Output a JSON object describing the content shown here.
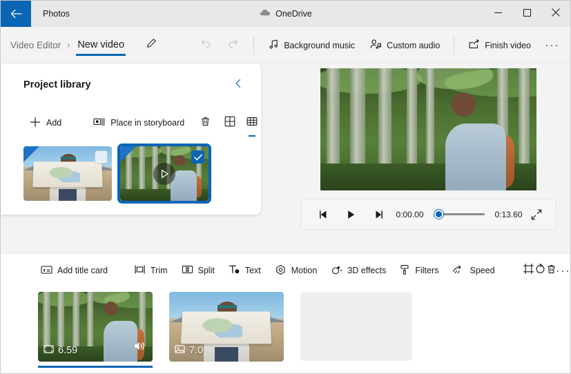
{
  "window": {
    "back_icon": "back-arrow-icon",
    "app_name": "Photos",
    "cloud_label": "OneDrive",
    "minimize": "minimize-icon",
    "maximize": "maximize-icon",
    "close": "close-icon"
  },
  "commandbar": {
    "breadcrumb_parent": "Video Editor",
    "breadcrumb_separator": "›",
    "breadcrumb_current": "New video",
    "rename_icon": "pencil-icon",
    "undo_icon": "undo-icon",
    "redo_icon": "redo-icon",
    "background_music": "Background music",
    "custom_audio": "Custom audio",
    "finish_video": "Finish video",
    "overflow": "···"
  },
  "library": {
    "title": "Project library",
    "collapse_icon": "chevron-left-icon",
    "add_label": "Add",
    "place_label": "Place in storyboard",
    "delete_icon": "trash-icon",
    "view_large_icon": "grid-large-icon",
    "view_small_icon": "grid-small-icon",
    "active_view": "grid-small-icon",
    "items": [
      {
        "name": "map-photo",
        "kind": "photo",
        "selected": false
      },
      {
        "name": "forest-video",
        "kind": "video",
        "selected": true
      }
    ]
  },
  "player": {
    "prev_frame_icon": "previous-frame-icon",
    "play_icon": "play-icon",
    "next_frame_icon": "next-frame-icon",
    "current_time": "0:00.00",
    "total_time": "0:13.60",
    "progress_percent": 0,
    "fullscreen_icon": "expand-icon"
  },
  "edit_toolbar": {
    "items": [
      {
        "label": "Add title card",
        "icon": "title-card-icon"
      },
      {
        "label": "Trim",
        "icon": "trim-icon"
      },
      {
        "label": "Split",
        "icon": "split-icon"
      },
      {
        "label": "Text",
        "icon": "text-icon"
      },
      {
        "label": "Motion",
        "icon": "motion-icon"
      },
      {
        "label": "3D effects",
        "icon": "three-d-effects-icon"
      },
      {
        "label": "Filters",
        "icon": "filters-icon"
      },
      {
        "label": "Speed",
        "icon": "speed-icon"
      }
    ],
    "crop_icon": "crop-icon",
    "rotate_icon": "rotate-icon",
    "delete_icon": "trash-icon",
    "overflow": "···"
  },
  "storyboard": {
    "clips": [
      {
        "name": "forest-clip",
        "duration": "6.59",
        "kind": "video",
        "kind_icon": "film-icon",
        "has_audio": true,
        "audio_icon": "speaker-icon",
        "selected": true
      },
      {
        "name": "map-clip",
        "duration": "7.0",
        "kind": "photo",
        "kind_icon": "image-icon",
        "has_audio": false,
        "selected": false
      }
    ],
    "empty_slot": true
  },
  "colors": {
    "accent": "#0a65b5",
    "titlebar_bg": "#e8e8e8",
    "app_bg": "#f3f3f3",
    "panel_bg": "#ffffff",
    "empty_slot": "#efefef"
  }
}
